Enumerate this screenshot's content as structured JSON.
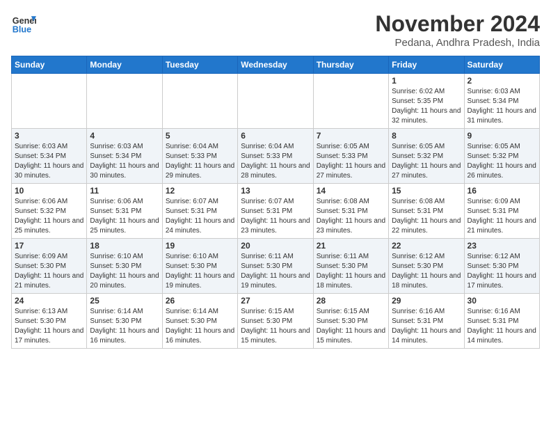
{
  "header": {
    "logo_line1": "General",
    "logo_line2": "Blue",
    "month": "November 2024",
    "location": "Pedana, Andhra Pradesh, India"
  },
  "days_of_week": [
    "Sunday",
    "Monday",
    "Tuesday",
    "Wednesday",
    "Thursday",
    "Friday",
    "Saturday"
  ],
  "weeks": [
    [
      {
        "day": "",
        "info": ""
      },
      {
        "day": "",
        "info": ""
      },
      {
        "day": "",
        "info": ""
      },
      {
        "day": "",
        "info": ""
      },
      {
        "day": "",
        "info": ""
      },
      {
        "day": "1",
        "info": "Sunrise: 6:02 AM\nSunset: 5:35 PM\nDaylight: 11 hours and 32 minutes."
      },
      {
        "day": "2",
        "info": "Sunrise: 6:03 AM\nSunset: 5:34 PM\nDaylight: 11 hours and 31 minutes."
      }
    ],
    [
      {
        "day": "3",
        "info": "Sunrise: 6:03 AM\nSunset: 5:34 PM\nDaylight: 11 hours and 30 minutes."
      },
      {
        "day": "4",
        "info": "Sunrise: 6:03 AM\nSunset: 5:34 PM\nDaylight: 11 hours and 30 minutes."
      },
      {
        "day": "5",
        "info": "Sunrise: 6:04 AM\nSunset: 5:33 PM\nDaylight: 11 hours and 29 minutes."
      },
      {
        "day": "6",
        "info": "Sunrise: 6:04 AM\nSunset: 5:33 PM\nDaylight: 11 hours and 28 minutes."
      },
      {
        "day": "7",
        "info": "Sunrise: 6:05 AM\nSunset: 5:33 PM\nDaylight: 11 hours and 27 minutes."
      },
      {
        "day": "8",
        "info": "Sunrise: 6:05 AM\nSunset: 5:32 PM\nDaylight: 11 hours and 27 minutes."
      },
      {
        "day": "9",
        "info": "Sunrise: 6:05 AM\nSunset: 5:32 PM\nDaylight: 11 hours and 26 minutes."
      }
    ],
    [
      {
        "day": "10",
        "info": "Sunrise: 6:06 AM\nSunset: 5:32 PM\nDaylight: 11 hours and 25 minutes."
      },
      {
        "day": "11",
        "info": "Sunrise: 6:06 AM\nSunset: 5:31 PM\nDaylight: 11 hours and 25 minutes."
      },
      {
        "day": "12",
        "info": "Sunrise: 6:07 AM\nSunset: 5:31 PM\nDaylight: 11 hours and 24 minutes."
      },
      {
        "day": "13",
        "info": "Sunrise: 6:07 AM\nSunset: 5:31 PM\nDaylight: 11 hours and 23 minutes."
      },
      {
        "day": "14",
        "info": "Sunrise: 6:08 AM\nSunset: 5:31 PM\nDaylight: 11 hours and 23 minutes."
      },
      {
        "day": "15",
        "info": "Sunrise: 6:08 AM\nSunset: 5:31 PM\nDaylight: 11 hours and 22 minutes."
      },
      {
        "day": "16",
        "info": "Sunrise: 6:09 AM\nSunset: 5:31 PM\nDaylight: 11 hours and 21 minutes."
      }
    ],
    [
      {
        "day": "17",
        "info": "Sunrise: 6:09 AM\nSunset: 5:30 PM\nDaylight: 11 hours and 21 minutes."
      },
      {
        "day": "18",
        "info": "Sunrise: 6:10 AM\nSunset: 5:30 PM\nDaylight: 11 hours and 20 minutes."
      },
      {
        "day": "19",
        "info": "Sunrise: 6:10 AM\nSunset: 5:30 PM\nDaylight: 11 hours and 19 minutes."
      },
      {
        "day": "20",
        "info": "Sunrise: 6:11 AM\nSunset: 5:30 PM\nDaylight: 11 hours and 19 minutes."
      },
      {
        "day": "21",
        "info": "Sunrise: 6:11 AM\nSunset: 5:30 PM\nDaylight: 11 hours and 18 minutes."
      },
      {
        "day": "22",
        "info": "Sunrise: 6:12 AM\nSunset: 5:30 PM\nDaylight: 11 hours and 18 minutes."
      },
      {
        "day": "23",
        "info": "Sunrise: 6:12 AM\nSunset: 5:30 PM\nDaylight: 11 hours and 17 minutes."
      }
    ],
    [
      {
        "day": "24",
        "info": "Sunrise: 6:13 AM\nSunset: 5:30 PM\nDaylight: 11 hours and 17 minutes."
      },
      {
        "day": "25",
        "info": "Sunrise: 6:14 AM\nSunset: 5:30 PM\nDaylight: 11 hours and 16 minutes."
      },
      {
        "day": "26",
        "info": "Sunrise: 6:14 AM\nSunset: 5:30 PM\nDaylight: 11 hours and 16 minutes."
      },
      {
        "day": "27",
        "info": "Sunrise: 6:15 AM\nSunset: 5:30 PM\nDaylight: 11 hours and 15 minutes."
      },
      {
        "day": "28",
        "info": "Sunrise: 6:15 AM\nSunset: 5:30 PM\nDaylight: 11 hours and 15 minutes."
      },
      {
        "day": "29",
        "info": "Sunrise: 6:16 AM\nSunset: 5:31 PM\nDaylight: 11 hours and 14 minutes."
      },
      {
        "day": "30",
        "info": "Sunrise: 6:16 AM\nSunset: 5:31 PM\nDaylight: 11 hours and 14 minutes."
      }
    ]
  ]
}
